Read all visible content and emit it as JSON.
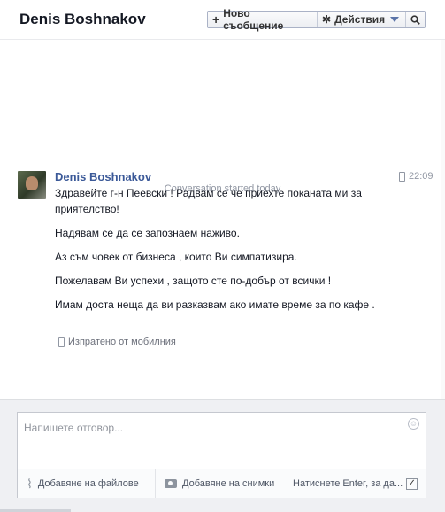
{
  "header": {
    "title": "Denis Boshnakov",
    "new_message_label": "Ново съобщение",
    "actions_label": "Действия",
    "icons": [
      "plus-icon",
      "gear-icon",
      "caret-down-icon",
      "search-icon"
    ]
  },
  "conversation": {
    "started_text": "Conversation started today",
    "message": {
      "sender": "Denis Boshnakov",
      "time": "22:09",
      "lines": [
        "Здравейте г-н Пеевски ! Радвам се че приехте поканата ми за приятелство!",
        "Надявам се да се запознаем наживо.",
        "Аз съм човек от бизнеса , които Ви симпатизира.",
        "Пожелавам Ви успехи , защото сте по-добър от всички !",
        "Имам доста неща да ви разказвам ако имате време за по кафе ."
      ],
      "sent_from": "Изпратено от мобилния"
    }
  },
  "compose": {
    "placeholder": "Напишете отговор...",
    "add_files_label": "Добавяне на файлове",
    "add_photos_label": "Добавяне на снимки",
    "enter_hint": "Натиснете Enter, за да..."
  }
}
